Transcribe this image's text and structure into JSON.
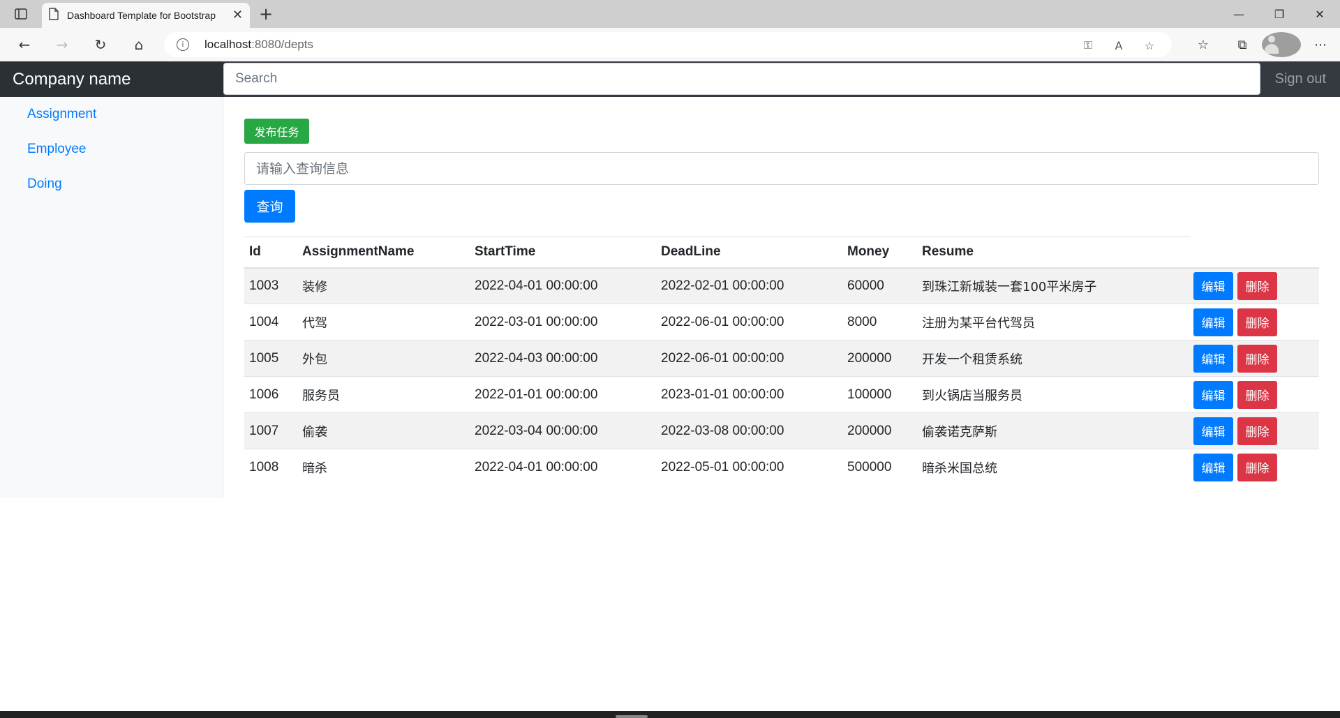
{
  "browser": {
    "tab_title": "Dashboard Template for Bootstrap",
    "url_host": "localhost",
    "url_rest": ":8080/depts"
  },
  "navbar": {
    "brand": "Company name",
    "search_placeholder": "Search",
    "signout": "Sign out"
  },
  "sidebar": {
    "items": [
      {
        "label": "Assignment"
      },
      {
        "label": "Employee"
      },
      {
        "label": "Doing"
      }
    ]
  },
  "main": {
    "publish_label": "发布任务",
    "query_placeholder": "请输入查询信息",
    "query_label": "查询",
    "edit_label": "编辑",
    "delete_label": "删除",
    "columns": [
      "Id",
      "AssignmentName",
      "StartTime",
      "DeadLine",
      "Money",
      "Resume"
    ],
    "rows": [
      {
        "id": "1003",
        "name": "装修",
        "start": "2022-04-01 00:00:00",
        "deadline": "2022-02-01 00:00:00",
        "money": "60000",
        "resume": "到珠江新城装一套100平米房子"
      },
      {
        "id": "1004",
        "name": "代驾",
        "start": "2022-03-01 00:00:00",
        "deadline": "2022-06-01 00:00:00",
        "money": "8000",
        "resume": "注册为某平台代驾员"
      },
      {
        "id": "1005",
        "name": "外包",
        "start": "2022-04-03 00:00:00",
        "deadline": "2022-06-01 00:00:00",
        "money": "200000",
        "resume": "开发一个租赁系统"
      },
      {
        "id": "1006",
        "name": "服务员",
        "start": "2022-01-01 00:00:00",
        "deadline": "2023-01-01 00:00:00",
        "money": "100000",
        "resume": "到火锅店当服务员"
      },
      {
        "id": "1007",
        "name": "偷袭",
        "start": "2022-03-04 00:00:00",
        "deadline": "2022-03-08 00:00:00",
        "money": "200000",
        "resume": "偷袭诺克萨斯"
      },
      {
        "id": "1008",
        "name": "暗杀",
        "start": "2022-04-01 00:00:00",
        "deadline": "2022-05-01 00:00:00",
        "money": "500000",
        "resume": "暗杀米国总统"
      }
    ]
  },
  "colors": {
    "navbar_bg": "#343a40",
    "primary": "#007bff",
    "success": "#28a745",
    "danger": "#dc3545"
  }
}
